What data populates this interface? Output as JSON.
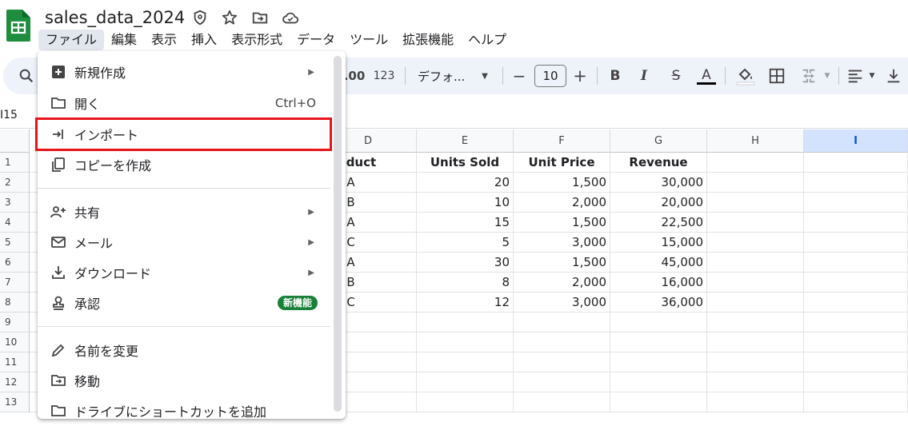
{
  "header": {
    "title": "sales_data_2024",
    "icons": [
      "shield-icon",
      "star-icon",
      "move-folder-icon",
      "cloud-status-icon"
    ]
  },
  "menubar": [
    "ファイル",
    "編集",
    "表示",
    "挿入",
    "表示形式",
    "データ",
    "ツール",
    "拡張機能",
    "ヘルプ"
  ],
  "toolbar": {
    "format_number": "123",
    "decimal_increase": ".00",
    "font": "デフォ...",
    "font_size": "10",
    "minus": "−",
    "plus": "+",
    "bold": "B",
    "italic": "I",
    "strike": "S",
    "textcolor": "A"
  },
  "namebox": "I15",
  "columns": [
    "D",
    "E",
    "F",
    "G",
    "H",
    "I"
  ],
  "rows": [
    "1",
    "2",
    "3",
    "4",
    "5",
    "6",
    "7",
    "8",
    "9",
    "10",
    "11",
    "12",
    "13"
  ],
  "table": {
    "headers": [
      "Product",
      "Units Sold",
      "Unit Price",
      "Revenue"
    ],
    "data": [
      [
        "get A",
        "20",
        "1,500",
        "30,000"
      ],
      [
        "get B",
        "10",
        "2,000",
        "20,000"
      ],
      [
        "get A",
        "15",
        "1,500",
        "22,500"
      ],
      [
        "get C",
        "5",
        "3,000",
        "15,000"
      ],
      [
        "get A",
        "30",
        "1,500",
        "45,000"
      ],
      [
        "get B",
        "8",
        "2,000",
        "16,000"
      ],
      [
        "get C",
        "12",
        "3,000",
        "36,000"
      ]
    ]
  },
  "file_menu": {
    "new": "新規作成",
    "open": "開く",
    "open_shortcut": "Ctrl+O",
    "import": "インポート",
    "copy": "コピーを作成",
    "share": "共有",
    "email": "メール",
    "download": "ダウンロード",
    "approval": "承認",
    "approval_badge": "新機能",
    "rename": "名前を変更",
    "move": "移動",
    "shortcut_partial": "ドライブにショートカットを追加"
  },
  "colors": {
    "accent": "#0b57d0",
    "badge": "#188038",
    "highlight": "#e8141c",
    "sheets_green": "#1e8e3e"
  }
}
